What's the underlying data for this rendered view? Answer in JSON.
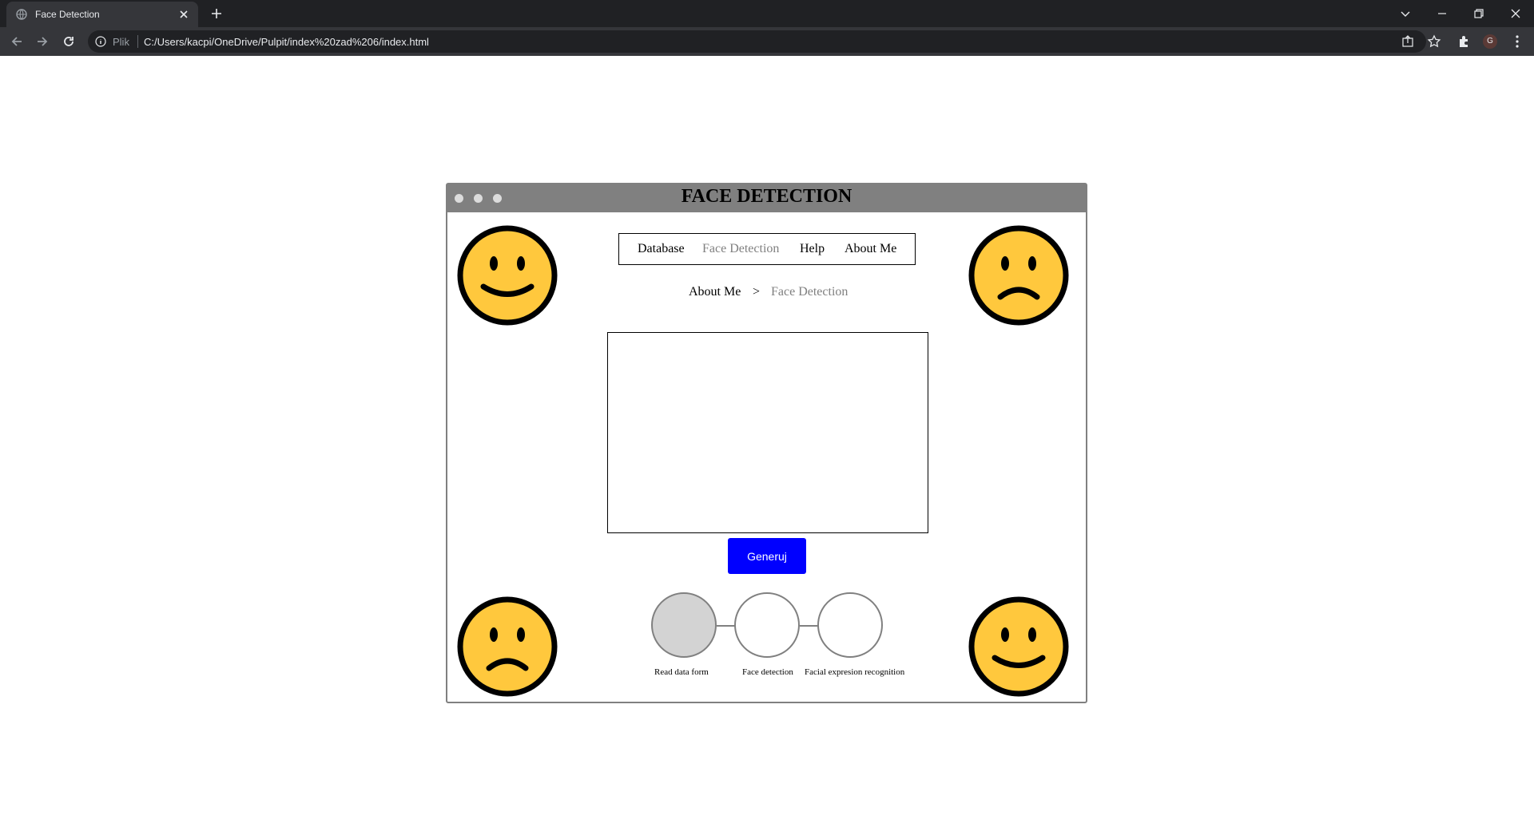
{
  "browser": {
    "tab_title": "Face Detection",
    "url_scheme": "Plik",
    "url": "C:/Users/kacpi/OneDrive/Pulpit/index%20zad%206/index.html",
    "profile_initial": "G"
  },
  "app": {
    "title": "FACE DETECTION",
    "nav": {
      "database": "Database",
      "face_detection": "Face Detection",
      "help": "Help",
      "about_me": "About Me"
    },
    "breadcrumb": {
      "parent": "About Me",
      "separator": ">",
      "current": "Face Detection"
    },
    "generate_button": "Generuj",
    "steps": [
      {
        "label": "Read data form",
        "state": "done"
      },
      {
        "label": "Face detection",
        "state": "pending"
      },
      {
        "label": "Facial expresion recognition",
        "state": "pending"
      }
    ],
    "faces": {
      "top_left": "happy-face-icon",
      "top_right": "sad-face-icon",
      "bottom_left": "sad-face-icon",
      "bottom_right": "happy-face-icon"
    },
    "colors": {
      "accent_button": "#0000ff",
      "title_bar": "#808080",
      "face_fill": "#ffc83d",
      "step_done": "#d3d3d3"
    }
  }
}
